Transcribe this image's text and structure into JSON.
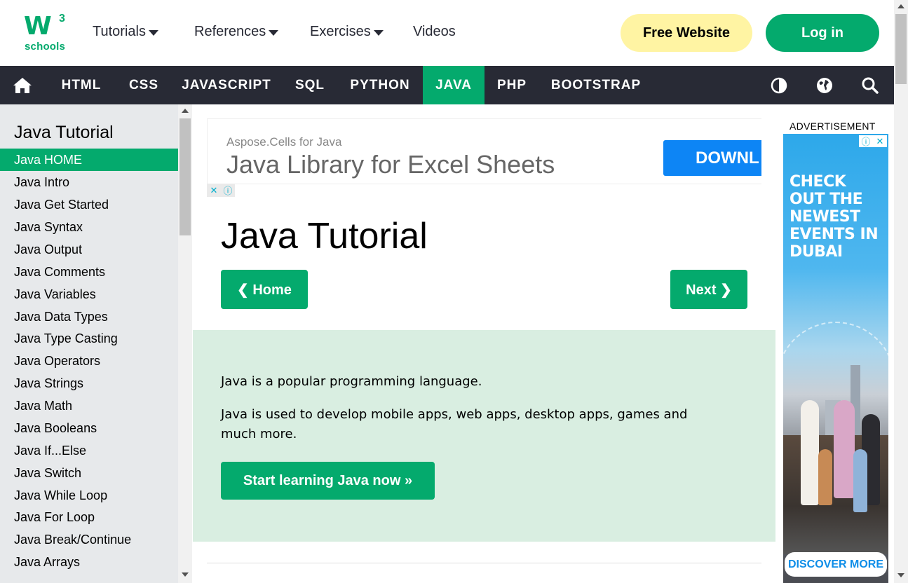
{
  "logo": {
    "w": "W",
    "three": "3",
    "schools": "schools"
  },
  "topnav": [
    {
      "label": "Tutorials",
      "dropdown": true
    },
    {
      "label": "References",
      "dropdown": true
    },
    {
      "label": "Exercises",
      "dropdown": true
    },
    {
      "label": "Videos",
      "dropdown": false
    }
  ],
  "header_buttons": {
    "free_website": "Free Website",
    "login": "Log in"
  },
  "darknav": {
    "items": [
      "HTML",
      "CSS",
      "JAVASCRIPT",
      "SQL",
      "PYTHON",
      "JAVA",
      "PHP",
      "BOOTSTRAP"
    ],
    "active": "JAVA",
    "icons": [
      "home-icon",
      "contrast-icon",
      "globe-icon",
      "search-icon"
    ]
  },
  "sidebar": {
    "title": "Java Tutorial",
    "items": [
      "Java HOME",
      "Java Intro",
      "Java Get Started",
      "Java Syntax",
      "Java Output",
      "Java Comments",
      "Java Variables",
      "Java Data Types",
      "Java Type Casting",
      "Java Operators",
      "Java Strings",
      "Java Math",
      "Java Booleans",
      "Java If...Else",
      "Java Switch",
      "Java While Loop",
      "Java For Loop",
      "Java Break/Continue",
      "Java Arrays"
    ],
    "active": "Java HOME"
  },
  "ad_top": {
    "small": "Aspose.Cells for Java",
    "big": "Java Library for Excel Sheets",
    "button": "DOWNL"
  },
  "main": {
    "title": "Java Tutorial",
    "home_button": "❮ Home",
    "next_button": "Next ❯",
    "intro_p1": "Java is a popular programming language.",
    "intro_p2": "Java is used to develop mobile apps, web apps, desktop apps, games and much more.",
    "start_button": "Start learning Java now »"
  },
  "ad_right": {
    "label": "ADVERTISEMENT",
    "headline": "CHECK OUT THE NEWEST EVENTS IN DUBAI",
    "cta": "DISCOVER MORE"
  },
  "colors": {
    "accent": "#04aa6d",
    "dark": "#282a35",
    "yellow": "#fff4a3",
    "intro_bg": "#d9eee1",
    "sidebar_bg": "#e7e9eb"
  }
}
